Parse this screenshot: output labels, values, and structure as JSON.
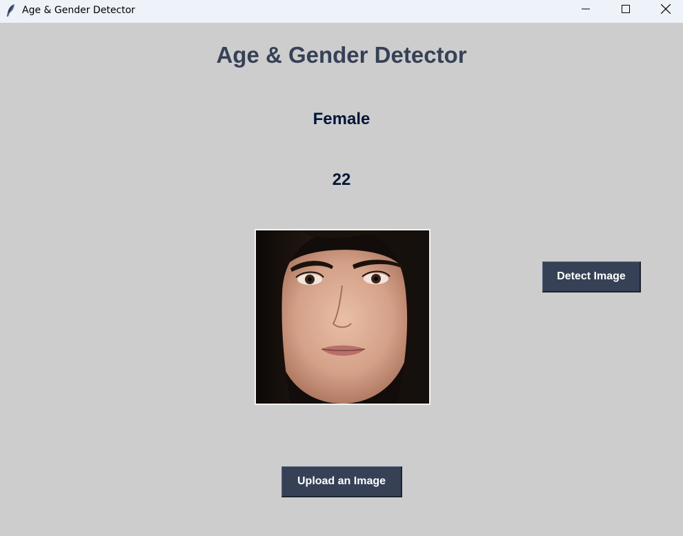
{
  "window": {
    "title": "Age & Gender Detector",
    "icon": "feather-icon",
    "controls": [
      "minimize-icon",
      "maximize-icon",
      "close-icon"
    ]
  },
  "main": {
    "heading": "Age & Gender Detector",
    "gender_result": "Female",
    "age_result": "22",
    "image": "uploaded-face-photo"
  },
  "buttons": {
    "detect_label": "Detect Image",
    "upload_label": "Upload an Image"
  },
  "colors": {
    "background": "#cdcdcd",
    "heading": "#364156",
    "result_text": "#011638",
    "button_bg": "#364156",
    "button_text": "#ffffff"
  }
}
